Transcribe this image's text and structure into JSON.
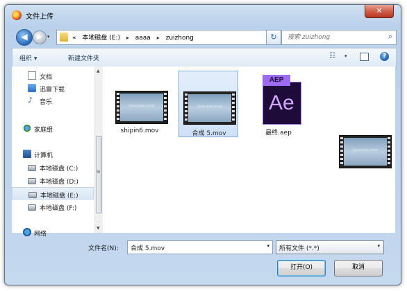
{
  "window": {
    "title": "文件上传",
    "close_label": "✕"
  },
  "address": {
    "back_glyph": "◀",
    "forward_glyph": "▶",
    "history_glyph": "▾",
    "prefix": "«",
    "crumbs": [
      "本地磁盘 (E:)",
      "aaaa",
      "zuizhong"
    ],
    "separator": "▸",
    "dropdown_glyph": "▾",
    "refresh_glyph": "↻"
  },
  "search": {
    "placeholder": "搜索 zuizhong",
    "icon": "search-icon"
  },
  "toolbar": {
    "organize": "组织 ▾",
    "new_folder": "新建文件夹",
    "view_glyph": "☷",
    "view_drop": "▾",
    "help": "?"
  },
  "sidebar": {
    "items": [
      {
        "label": "文档",
        "icon": "document-icon"
      },
      {
        "label": "迅雷下载",
        "icon": "download-folder-icon"
      },
      {
        "label": "音乐",
        "icon": "music-icon"
      },
      {
        "label": "家庭组",
        "icon": "homegroup-icon"
      },
      {
        "label": "计算机",
        "icon": "computer-icon"
      },
      {
        "label": "本地磁盘 (C:)",
        "icon": "drive-icon"
      },
      {
        "label": "本地磁盘 (D:)",
        "icon": "drive-icon"
      },
      {
        "label": "本地磁盘 (E:)",
        "icon": "drive-icon",
        "selected": true
      },
      {
        "label": "本地磁盘 (F:)",
        "icon": "drive-icon"
      },
      {
        "label": "网络",
        "icon": "network-icon"
      }
    ],
    "scroll_up": "▲",
    "scroll_down": "▼",
    "scroll_grip": "≡"
  },
  "files": [
    {
      "name": "shipin6.mov",
      "type": "video",
      "thumb_text": "Come back school"
    },
    {
      "name": "合成 5.mov",
      "type": "video",
      "thumb_text": "Come back school",
      "selected": true
    },
    {
      "name": "最终.aep",
      "type": "aep",
      "tab_text": "AEP",
      "big_text": "Ae"
    }
  ],
  "preview": {
    "thumb_text": "Come back school"
  },
  "bottom": {
    "filename_label": "文件名(N):",
    "filename_value": "合成 5.mov",
    "dropdown_glyph": "▾",
    "filetype_value": "所有文件 (*.*)",
    "open_label": "打开(O)",
    "cancel_label": "取消"
  },
  "colors": {
    "accent": "#2a62b5",
    "close": "#c94a33",
    "selection": "#cfe1f7",
    "ae": "#9b6cf0"
  }
}
